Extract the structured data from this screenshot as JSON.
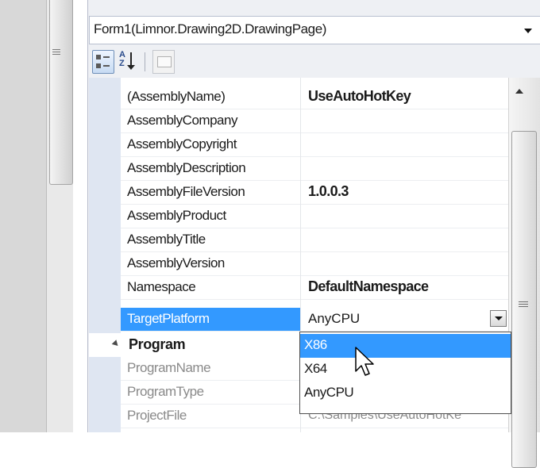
{
  "object_selector": {
    "value": "Form1(Limnor.Drawing2D.DrawingPage)"
  },
  "toolbar": {
    "categorized_icon": "categorized-icon",
    "alphabetical_icon": "sort-az-icon",
    "alphabetical_text": "A Z",
    "property_pages_icon": "property-pages-icon"
  },
  "properties": [
    {
      "name": "(AssemblyName)",
      "value": "UseAutoHotKey",
      "bold": true
    },
    {
      "name": "AssemblyCompany",
      "value": ""
    },
    {
      "name": "AssemblyCopyright",
      "value": ""
    },
    {
      "name": "AssemblyDescription",
      "value": ""
    },
    {
      "name": "AssemblyFileVersion",
      "value": "1.0.0.3",
      "bold": true
    },
    {
      "name": "AssemblyProduct",
      "value": ""
    },
    {
      "name": "AssemblyTitle",
      "value": ""
    },
    {
      "name": "AssemblyVersion",
      "value": ""
    },
    {
      "name": "Namespace",
      "value": "DefaultNamespace",
      "bold": true
    },
    {
      "name": "TargetPlatform",
      "value": "AnyCPU",
      "selected": true
    }
  ],
  "category": {
    "name": "Program"
  },
  "program_properties": [
    {
      "name": "ProgramName",
      "value": ""
    },
    {
      "name": "ProgramType",
      "value": ""
    },
    {
      "name": "ProjectFile",
      "value": "C:\\Samples\\UseAutoHotKe"
    }
  ],
  "dropdown": {
    "options": [
      "X86",
      "X64",
      "AnyCPU"
    ],
    "highlighted": "X86"
  },
  "colors": {
    "selection": "#3399ff",
    "gutter": "#dfe6f2"
  }
}
